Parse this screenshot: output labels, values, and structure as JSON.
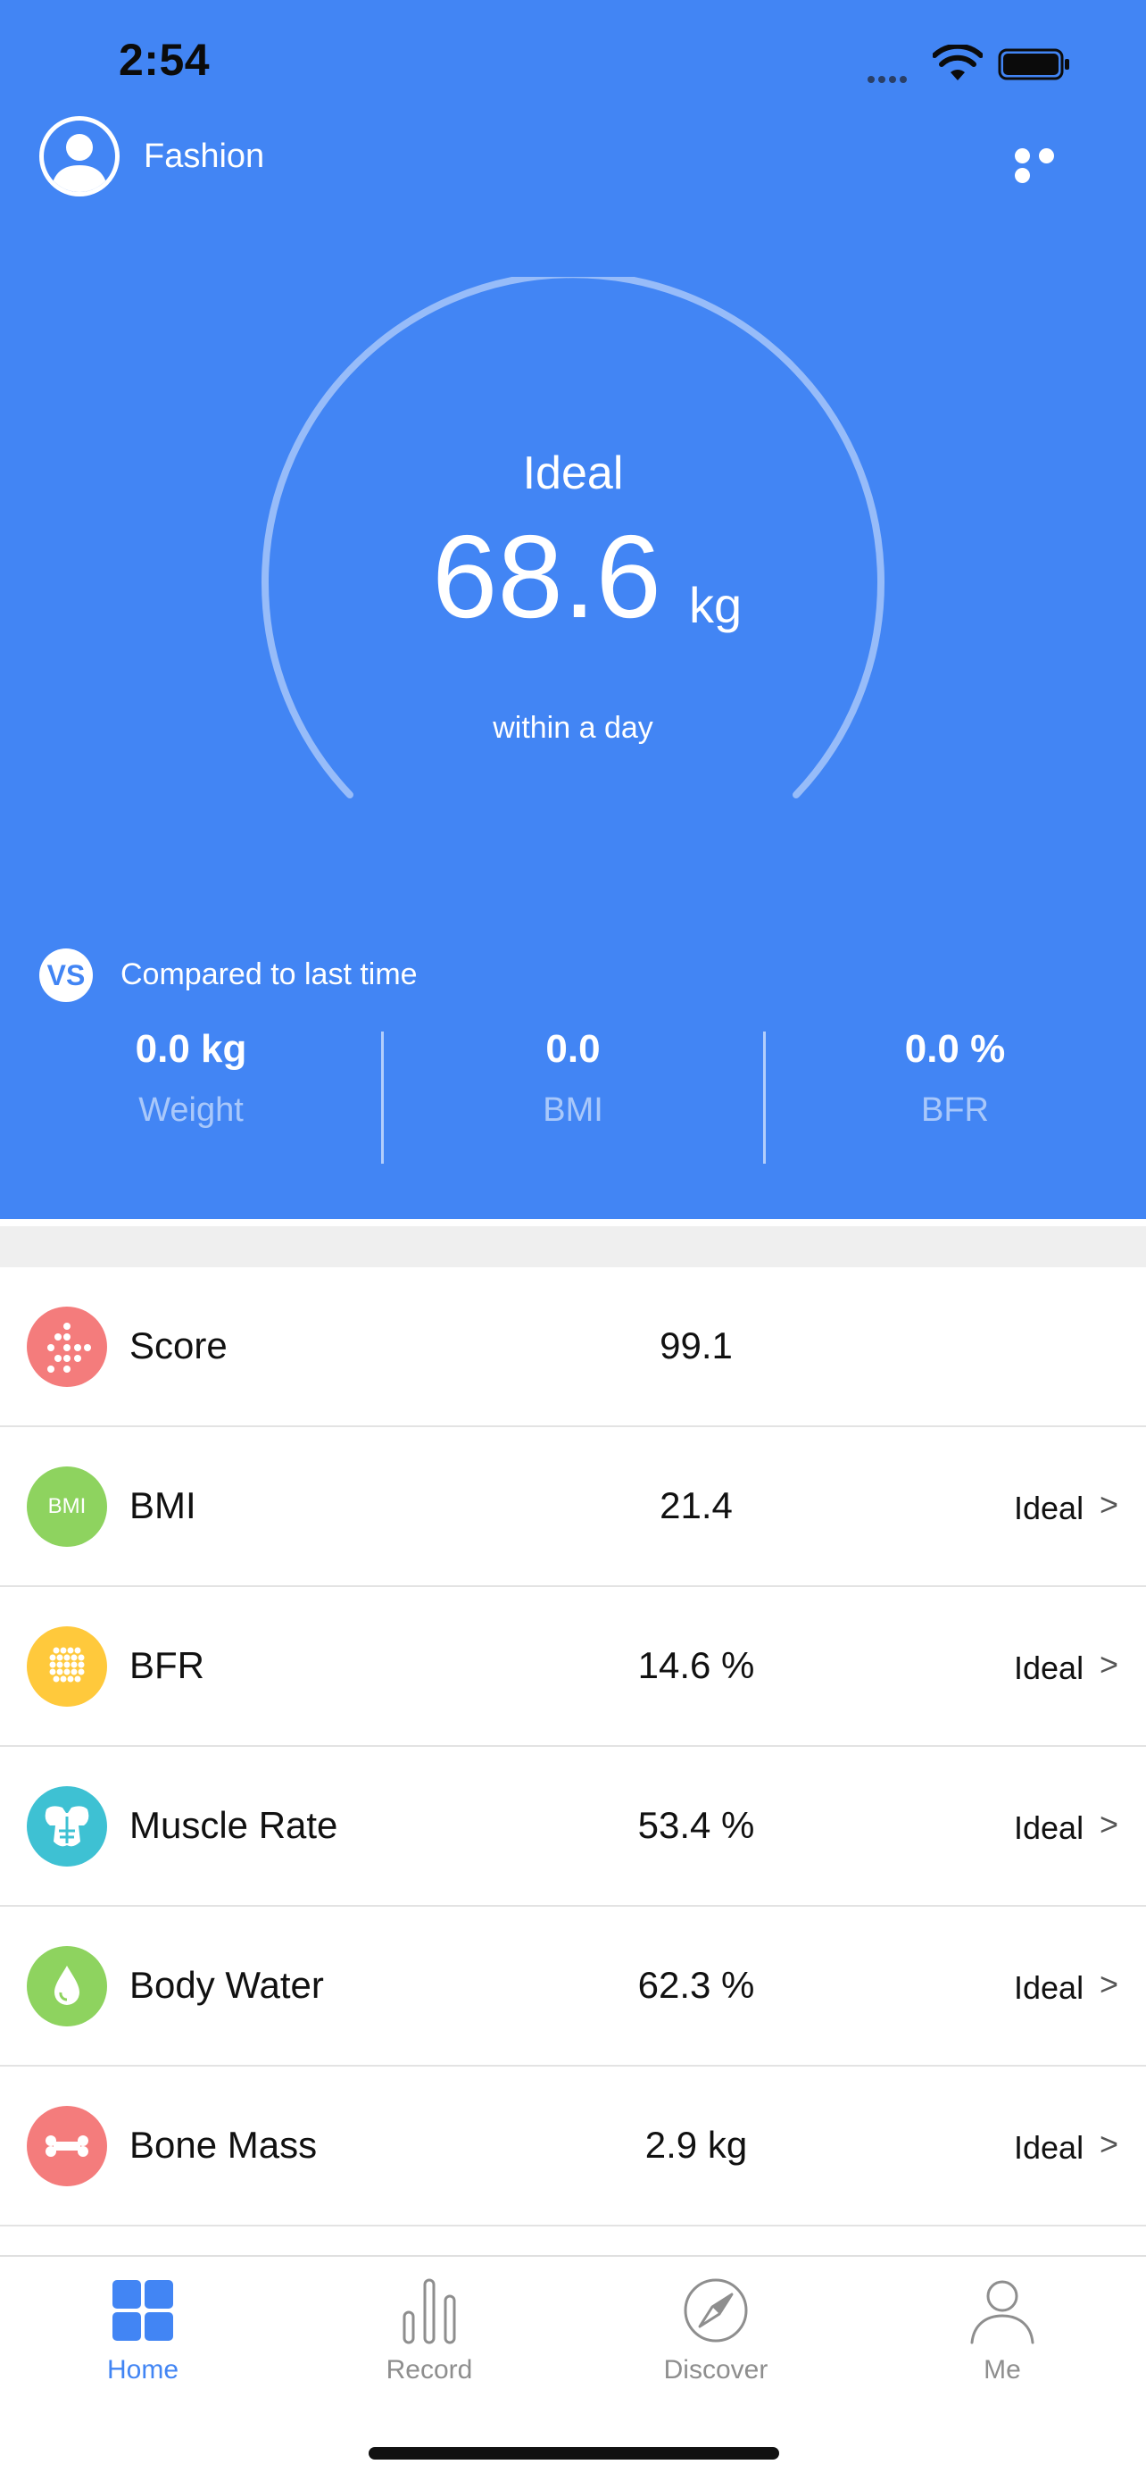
{
  "status_bar": {
    "time": "2:54"
  },
  "header": {
    "username": "Fashion"
  },
  "gauge": {
    "status": "Ideal",
    "value": "68.6",
    "unit": "kg",
    "subtitle": "within a day"
  },
  "compare": {
    "badge": "VS",
    "label": "Compared to last time",
    "items": [
      {
        "value": "0.0 kg",
        "label": "Weight"
      },
      {
        "value": "0.0",
        "label": "BMI"
      },
      {
        "value": "0.0 %",
        "label": "BFR"
      }
    ]
  },
  "metrics": [
    {
      "name": "Score",
      "value": "99.1",
      "status": "",
      "icon": "score-dots-icon",
      "color": "#F47C7C"
    },
    {
      "name": "BMI",
      "value": "21.4",
      "status": "Ideal",
      "icon": "bmi-icon",
      "icon_text": "BMI",
      "color": "#8ED35F"
    },
    {
      "name": "BFR",
      "value": "14.6 %",
      "status": "Ideal",
      "icon": "fat-cells-icon",
      "color": "#FFC93C"
    },
    {
      "name": "Muscle Rate",
      "value": "53.4 %",
      "status": "Ideal",
      "icon": "muscle-icon",
      "color": "#3EC1D3"
    },
    {
      "name": "Body Water",
      "value": "62.3 %",
      "status": "Ideal",
      "icon": "water-drop-icon",
      "color": "#8ED35F"
    },
    {
      "name": "Bone Mass",
      "value": "2.9 kg",
      "status": "Ideal",
      "icon": "bone-icon",
      "color": "#F47C7C"
    }
  ],
  "chevron": ">",
  "tabs": [
    {
      "label": "Home",
      "icon": "home-grid-icon",
      "active": true
    },
    {
      "label": "Record",
      "icon": "bar-chart-icon",
      "active": false
    },
    {
      "label": "Discover",
      "icon": "compass-icon",
      "active": false
    },
    {
      "label": "Me",
      "icon": "person-icon",
      "active": false
    }
  ],
  "colors": {
    "primary": "#4285F4",
    "background": "#FFFFFF",
    "separator": "#EFEFEF"
  }
}
